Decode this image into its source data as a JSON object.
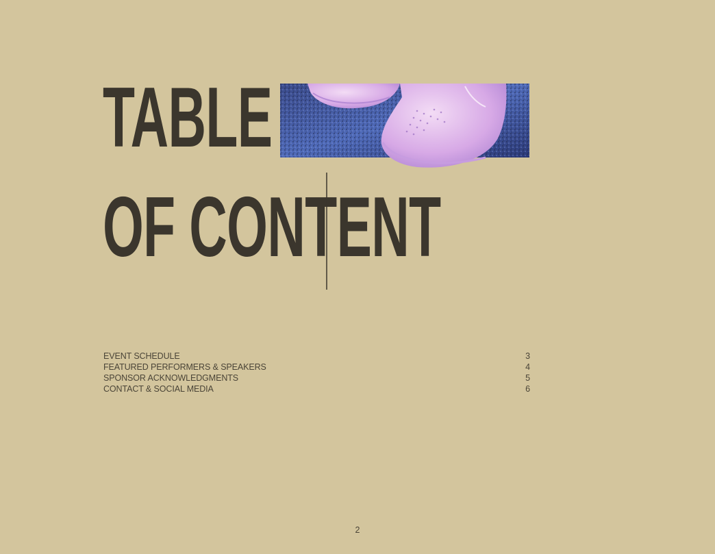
{
  "heading": {
    "line1": "TABLE",
    "line2": "OF CONTENT"
  },
  "toc": [
    {
      "label": "EVENT SCHEDULE",
      "page": "3"
    },
    {
      "label": "FEATURED PERFORMERS & SPEAKERS",
      "page": "4"
    },
    {
      "label": "SPONSOR ACKNOWLEDGMENTS",
      "page": "5"
    },
    {
      "label": "CONTACT & SOCIAL MEDIA",
      "page": "6"
    }
  ],
  "page_number": "2",
  "colors": {
    "background": "#d3c59d",
    "heading": "#3b362d",
    "text": "#4a4437"
  }
}
